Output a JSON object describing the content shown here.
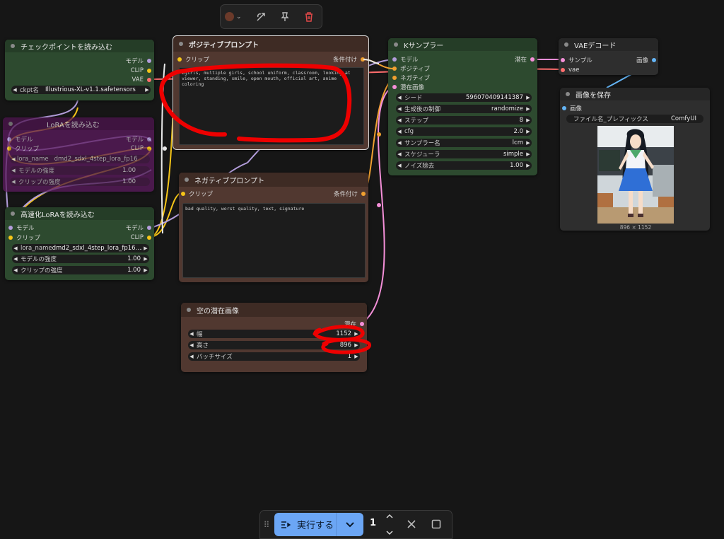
{
  "colors": {
    "canvas": "#161616",
    "green_node": "#2d4a2f",
    "brown_node": "#513830",
    "gray_node": "#2e2e2e",
    "purple_node": "#5c1b5e",
    "model_wire": "#b39ddb",
    "clip_wire": "#f5c518",
    "vae_wire": "#ff6e6e",
    "latent_wire": "#f48fd8",
    "conditioning_wire": "#f0a030",
    "image_wire": "#64b5f6",
    "run_button": "#6ba6f5",
    "annotation_red": "#ee0000"
  },
  "toolbar": {
    "color_icon": "color-swatch-icon",
    "bypass_icon": "bypass-icon",
    "pin_icon": "pin-icon",
    "delete_icon": "trash-icon"
  },
  "nodes": {
    "checkpoint": {
      "title": "チェックポイントを読み込む",
      "outputs": [
        "モデル",
        "CLIP",
        "VAE"
      ],
      "widget_label": "ckpt名",
      "widget_value": "Illustrious-XL-v1.1.safetensors"
    },
    "lora_bypassed": {
      "title": "LoRAを読み込む",
      "input_model": "モデル",
      "input_clip": "クリップ",
      "output_model": "モデル",
      "output_clip": "CLIP",
      "w1_label": "lora_name",
      "w1_value": "dmd2_sdxl_4step_lora_fp16",
      "w2_label": "モデルの強度",
      "w2_value": "1.00",
      "w3_label": "クリップの強度",
      "w3_value": "1.00"
    },
    "lora_fast": {
      "title": "高速化LoRAを読み込む",
      "input_model": "モデル",
      "input_clip": "クリップ",
      "output_model": "モデル",
      "output_clip": "CLIP",
      "w1_label": "lora_name",
      "w1_value": "dmd2_sdxl_4step_lora_fp16....",
      "w2_label": "モデルの強度",
      "w2_value": "1.00",
      "w3_label": "クリップの強度",
      "w3_value": "1.00"
    },
    "positive": {
      "title": "ポジティブプロンプト",
      "input": "クリップ",
      "output": "条件付け",
      "text": "2girls, multiple girls, school uniform, classroom, looking at viewer, standing, smile, open mouth, official art, anime coloring"
    },
    "negative": {
      "title": "ネガティブプロンプト",
      "input": "クリップ",
      "output": "条件付け",
      "text": "bad quality, worst quality, text, signature"
    },
    "empty_latent": {
      "title": "空の潜在画像",
      "output": "潜在",
      "w1_label": "幅",
      "w1_value": "1152",
      "w2_label": "高さ",
      "w2_value": "896",
      "w3_label": "バッチサイズ",
      "w3_value": "1"
    },
    "ksampler": {
      "title": "Kサンプラー",
      "inputs": [
        "モデル",
        "ポジティブ",
        "ネガティブ",
        "潜在画像"
      ],
      "output": "潜在",
      "widgets": [
        {
          "label": "シード",
          "value": "596070409141387"
        },
        {
          "label": "生成後の制御",
          "value": "randomize"
        },
        {
          "label": "ステップ",
          "value": "8"
        },
        {
          "label": "cfg",
          "value": "2.0"
        },
        {
          "label": "サンプラー名",
          "value": "lcm"
        },
        {
          "label": "スケジューラ",
          "value": "simple"
        },
        {
          "label": "ノイズ除去",
          "value": "1.00"
        }
      ]
    },
    "vae_decode": {
      "title": "VAEデコード",
      "input_samples": "サンプル",
      "input_vae": "vae",
      "output": "画像"
    },
    "save_image": {
      "title": "画像を保存",
      "input": "画像",
      "widget_label": "ファイル名_プレフィックス",
      "widget_value": "ComfyUI",
      "caption": "896 × 1152"
    }
  },
  "runbar": {
    "run_label": "実行する",
    "batch_count": "1"
  }
}
